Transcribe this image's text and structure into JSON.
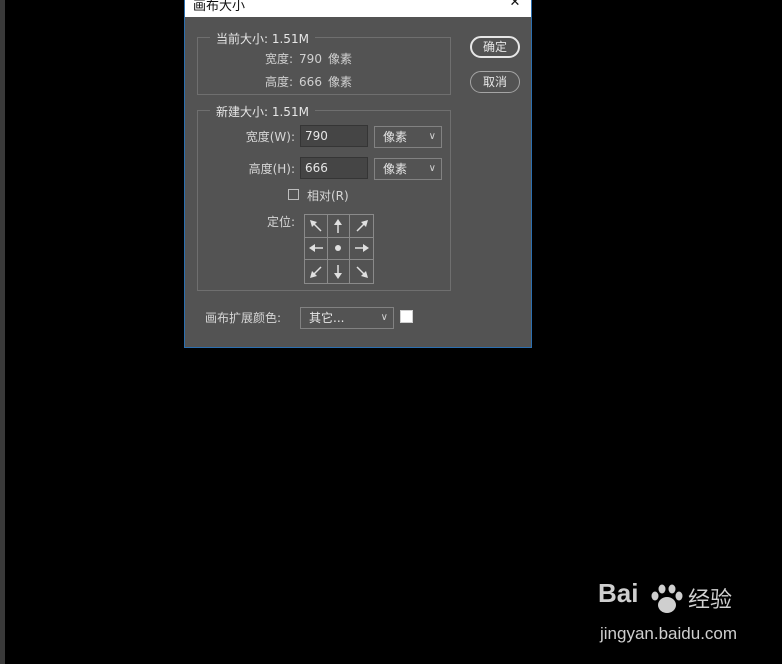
{
  "dialog": {
    "title": "画布大小",
    "close_symbol": "✕",
    "ok_label": "确定",
    "cancel_label": "取消"
  },
  "current_size": {
    "legend": "当前大小: 1.51M",
    "width_label": "宽度:",
    "width_value": "790",
    "width_unit": "像素",
    "height_label": "高度:",
    "height_value": "666",
    "height_unit": "像素"
  },
  "new_size": {
    "legend": "新建大小: 1.51M",
    "width_label": "宽度(W):",
    "width_value": "790",
    "width_unit": "像素",
    "height_label": "高度(H):",
    "height_value": "666",
    "height_unit": "像素",
    "relative_label": "相对(R)",
    "relative_checked": false,
    "anchor_label": "定位:",
    "anchor_selected": "center"
  },
  "canvas_ext": {
    "label": "画布扩展颜色:",
    "value": "其它...",
    "swatch_color": "#ffffff"
  },
  "watermark": {
    "brand": "Bai",
    "brand_suffix": "经验",
    "url": "jingyan.baidu.com"
  },
  "colors": {
    "dialog_bg": "#535353",
    "canvas_bg": "#000000",
    "title_bar": "#ffffff",
    "dialog_border": "#2c6fb0"
  }
}
